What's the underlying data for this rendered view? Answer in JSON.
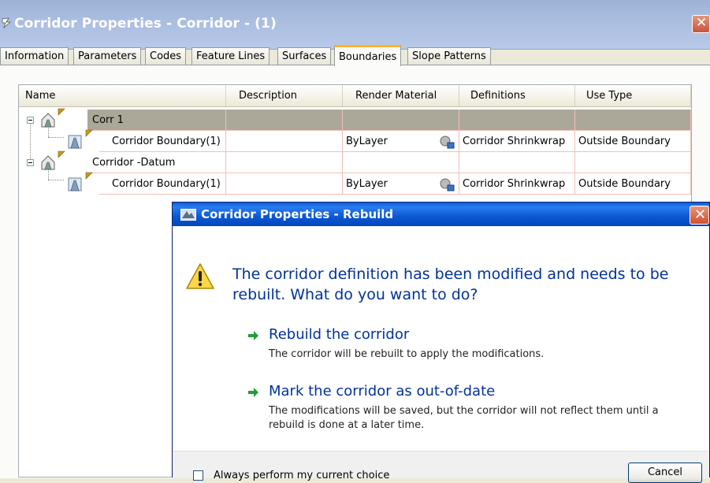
{
  "main_window": {
    "title": "Corridor Properties - Corridor - (1)",
    "close_glyph": "✕"
  },
  "tabs": [
    {
      "label": "Information",
      "active": false
    },
    {
      "label": "Parameters",
      "active": false
    },
    {
      "label": "Codes",
      "active": false
    },
    {
      "label": "Feature Lines",
      "active": false
    },
    {
      "label": "Surfaces",
      "active": false
    },
    {
      "label": "Boundaries",
      "active": true
    },
    {
      "label": "Slope Patterns",
      "active": false
    }
  ],
  "grid": {
    "columns": [
      "Name",
      "Description",
      "Render Material",
      "Definitions",
      "Use Type"
    ],
    "rows": [
      {
        "name": "Corr 1",
        "description": "",
        "render_material": "",
        "definitions": "",
        "use_type": "",
        "level": 0,
        "selected": true
      },
      {
        "name": "Corridor Boundary(1)",
        "description": "",
        "render_material": "ByLayer",
        "definitions": "Corridor Shrinkwrap",
        "use_type": "Outside Boundary",
        "level": 1,
        "selected": false
      },
      {
        "name": "Corridor -Datum",
        "description": "",
        "render_material": "",
        "definitions": "",
        "use_type": "",
        "level": 0,
        "selected": false
      },
      {
        "name": "Corridor Boundary(1)",
        "description": "",
        "render_material": "ByLayer",
        "definitions": "Corridor Shrinkwrap",
        "use_type": "Outside Boundary",
        "level": 1,
        "selected": false
      }
    ]
  },
  "dialog": {
    "title": "Corridor Properties - Rebuild",
    "close_glyph": "✕",
    "main_instruction": "The corridor definition has been modified and needs to be rebuilt.  What do you want to do?",
    "commands": [
      {
        "title": "Rebuild the corridor",
        "description": "The corridor will be rebuilt to apply the modifications."
      },
      {
        "title": "Mark the corridor as out-of-date",
        "description": "The modifications will be saved, but the corridor will not reflect them until a rebuild is done at a later time."
      }
    ],
    "checkbox_label": "Always perform my current choice",
    "cancel_label": "Cancel"
  },
  "icons": {
    "tree_parent": "corridor-icon",
    "tree_child": "boundary-icon",
    "material": "material-browse-icon",
    "warning": "warning-icon",
    "command": "green-arrow-icon"
  },
  "colors": {
    "dialog_titlebar": "#0a5fd8",
    "instruction_text": "#003399",
    "selected_row": "#aca899",
    "active_tab_accent": "#f8b42f"
  }
}
